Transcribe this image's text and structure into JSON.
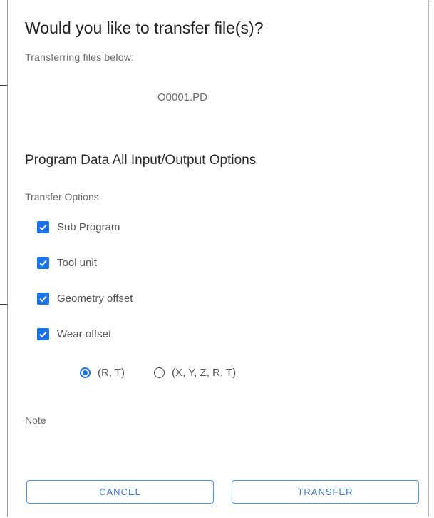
{
  "dialog": {
    "title": "Would you like to transfer file(s)?",
    "subtitle": "Transferring files below:",
    "file_name": "O0001.PD",
    "section_heading": "Program Data All Input/Output Options",
    "transfer_options_label": "Transfer Options",
    "checkboxes": [
      {
        "label": "Sub Program",
        "checked": true
      },
      {
        "label": "Tool unit",
        "checked": true
      },
      {
        "label": "Geometry offset",
        "checked": true
      },
      {
        "label": "Wear offset",
        "checked": true
      }
    ],
    "radio_options": [
      {
        "label": "(R, T)",
        "selected": true
      },
      {
        "label": "(X, Y, Z, R, T)",
        "selected": false
      }
    ],
    "note_label": "Note",
    "cancel_label": "CANCEL",
    "transfer_label": "TRANSFER"
  },
  "colors": {
    "accent": "#1a73e8",
    "button_text": "#3b78d8",
    "text_primary": "#222222",
    "text_secondary": "#6b6b6b"
  }
}
